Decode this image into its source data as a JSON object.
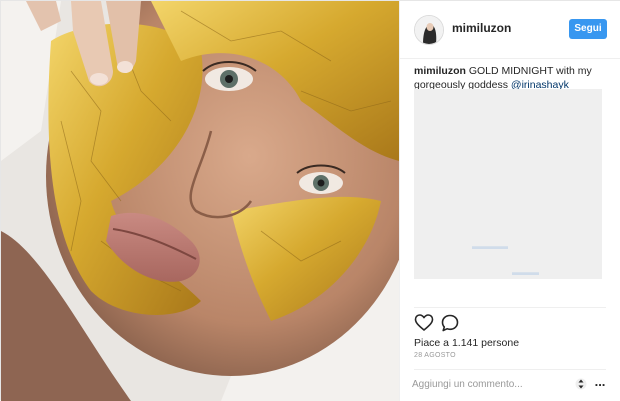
{
  "post": {
    "username": "mimiluzon",
    "follow_label": "Segui",
    "caption_user": "mimiluzon",
    "caption_text": " GOLD MIDNIGHT with my gorgeously goddess ",
    "caption_mention": "@irinashayk",
    "likes_text": "Piace a 1.141 persone",
    "date_text": "28 AGOSTO",
    "comment_placeholder": "Aggiungi un commento...",
    "more_label": "..."
  },
  "icons": {
    "like": "heart-icon",
    "comment": "speech-bubble-icon",
    "sort": "sort-arrows-icon",
    "more": "ellipsis-icon"
  },
  "colors": {
    "follow_button": "#3897f0",
    "mention": "#003569",
    "redacted_block": "#efefef",
    "gold_mask": "#d9ae35"
  }
}
